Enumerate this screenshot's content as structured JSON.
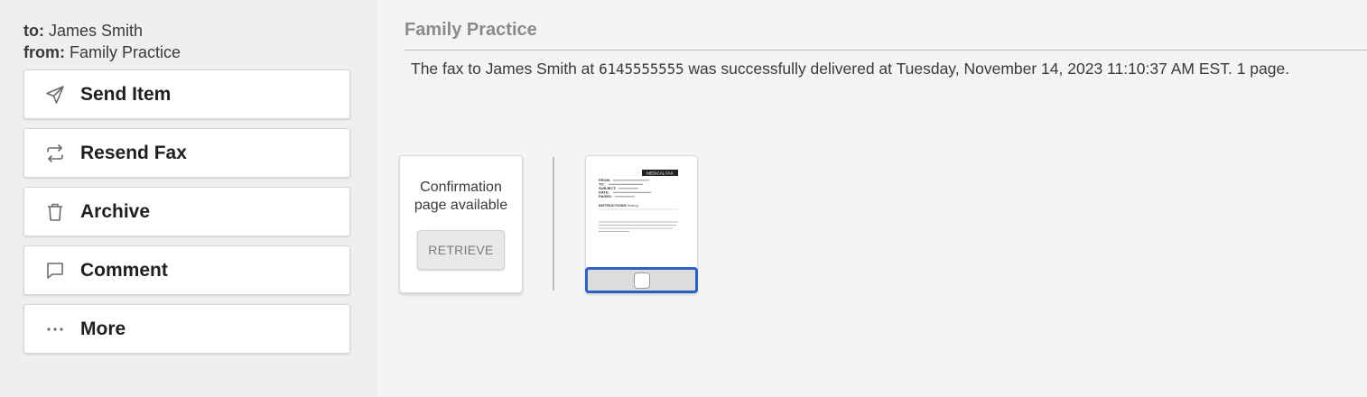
{
  "message": {
    "to_label": "to:",
    "to_value": "James Smith",
    "from_label": "from:",
    "from_value": "Family Practice"
  },
  "actions": [
    {
      "label": "Send Item",
      "icon": "send-icon"
    },
    {
      "label": "Resend Fax",
      "icon": "resend-icon"
    },
    {
      "label": "Archive",
      "icon": "trash-icon"
    },
    {
      "label": "Comment",
      "icon": "comment-icon"
    },
    {
      "label": "More",
      "icon": "more-icon"
    }
  ],
  "main": {
    "title": "Family Practice",
    "status_prefix": "The fax to James Smith at",
    "fax_number": "6145555555",
    "status_suffix": "was successfully delivered at Tuesday, November 14, 2023 11:10:37 AM EST. 1 page."
  },
  "confirmation": {
    "line1": "Confirmation",
    "line2": "page available",
    "button": "RETRIEVE"
  },
  "thumbnail": {
    "header_badge": "MEDICAL FAX",
    "fields": [
      "FROM:",
      "TO:",
      "SUBJECT:",
      "DATE:",
      "PAGES:"
    ],
    "instructions_label": "INSTRUCTIONS:",
    "instructions_value": "Testing",
    "selected": false
  },
  "colors": {
    "selection_border": "#2c62c6",
    "sidebar_bg": "#efefef",
    "main_bg": "#f4f4f4"
  }
}
